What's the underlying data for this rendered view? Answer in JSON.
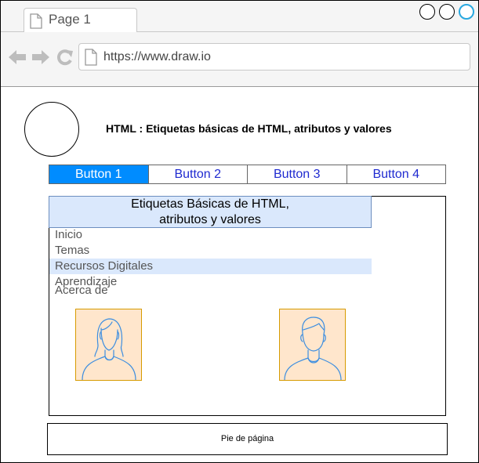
{
  "browser": {
    "tab_label": "Page 1",
    "url": "https://www.draw.io",
    "nav_icons": [
      "back-arrow-icon",
      "forward-arrow-icon",
      "reload-icon"
    ],
    "window_buttons": [
      "window-button",
      "window-button",
      "window-button"
    ],
    "accent_color": "#29a8e0"
  },
  "header": {
    "title": "HTML : Etiquetas básicas de HTML, atributos y valores"
  },
  "button_bar": {
    "buttons": [
      "Button 1",
      "Button 2",
      "Button 3",
      "Button 4"
    ],
    "active_index": 0,
    "active_color": "#008cff",
    "text_color": "#1f2ad0"
  },
  "panel": {
    "heading_line1": "Etiquetas Básicas de HTML,",
    "heading_line2": "atributos y valores",
    "menu": [
      "Inicio",
      "Temas",
      "Recursos Digitales",
      "Aprendizaje",
      "Acerca de"
    ],
    "highlighted_item": "Recursos Digitales",
    "highlight_color": "#dae8fc",
    "avatars": [
      "female-user-icon",
      "male-user-icon"
    ]
  },
  "footer": {
    "text": "Pie de página"
  }
}
